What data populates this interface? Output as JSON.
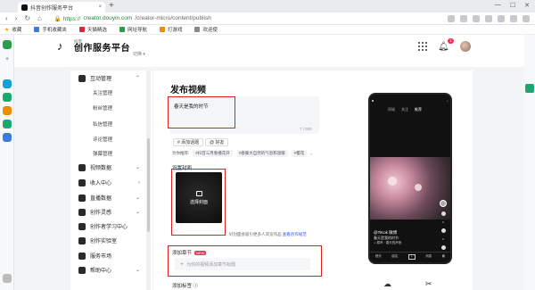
{
  "browser": {
    "tab_title": "抖音创作服务平台",
    "tab_close": "×",
    "new_tab": "+",
    "win_controls": [
      "—",
      "☐",
      "✕"
    ],
    "nav_buttons": [
      "‹",
      "›",
      "↻",
      "⌂"
    ],
    "url_secure": "🔒 https://",
    "url_host": "creator.douyin.com",
    "url_path": "/creator-micro/content/publish",
    "bookmarks": [
      "收藏",
      "手机收藏夹",
      "天猫精选",
      "网址导航",
      "打游戏",
      "欢迎使"
    ]
  },
  "header": {
    "logo_small": "抖音",
    "logo_title": "创作服务平台",
    "switch_label": "切换 ▾",
    "notification_count": "1"
  },
  "nav": {
    "group_interaction": "互动管理",
    "sub_items": [
      "关注管理",
      "粉丝管理",
      "私信管理",
      "评论管理",
      "弹幕管理"
    ],
    "items": [
      "视频数据",
      "收入中心",
      "直播数据",
      "创作灵感",
      "创作者学习中心",
      "创作实验室",
      "服务市场",
      "帮助中心"
    ],
    "chev_up": "⌃",
    "chev_down": "⌄",
    "chev_right": "›"
  },
  "main": {
    "title": "发布视频",
    "desc_text": "春天是我的时节",
    "counter": "7 / 500",
    "chip_topic": "# 添加话题",
    "chip_friend": "@ 好友",
    "suggest_label": "为你推荐:",
    "suggest_tags": [
      "#抖音三月春播花开",
      "#春暖大自然的气息和温暖",
      "#樱花"
    ],
    "suggest_more": "›",
    "cover_label": "设置封面",
    "cover_button": "选择封面",
    "cover_hint": "好封面会吸引更多人浏览作品",
    "cover_hint_link": "查看创作规范",
    "chapter_label": "添加章节",
    "chapter_new": "NEW",
    "chapter_plus": "+",
    "chapter_placeholder": "为你的视频添加章节标题",
    "label_label": "添加标签 ⓘ"
  },
  "preview": {
    "top_left": "◙",
    "top_right": "⌕",
    "tabs": [
      "同城",
      "关注",
      "推荐"
    ],
    "side_counts": [
      "0",
      "0",
      "0"
    ],
    "author": "@TiKok 微博",
    "caption": "春天是我的时节",
    "music": "♫ 原声 · 春天的声音",
    "nav": [
      "首页",
      "朋友",
      "+",
      "消息",
      "我"
    ],
    "bottom_icons": [
      "☁",
      "✂"
    ]
  }
}
